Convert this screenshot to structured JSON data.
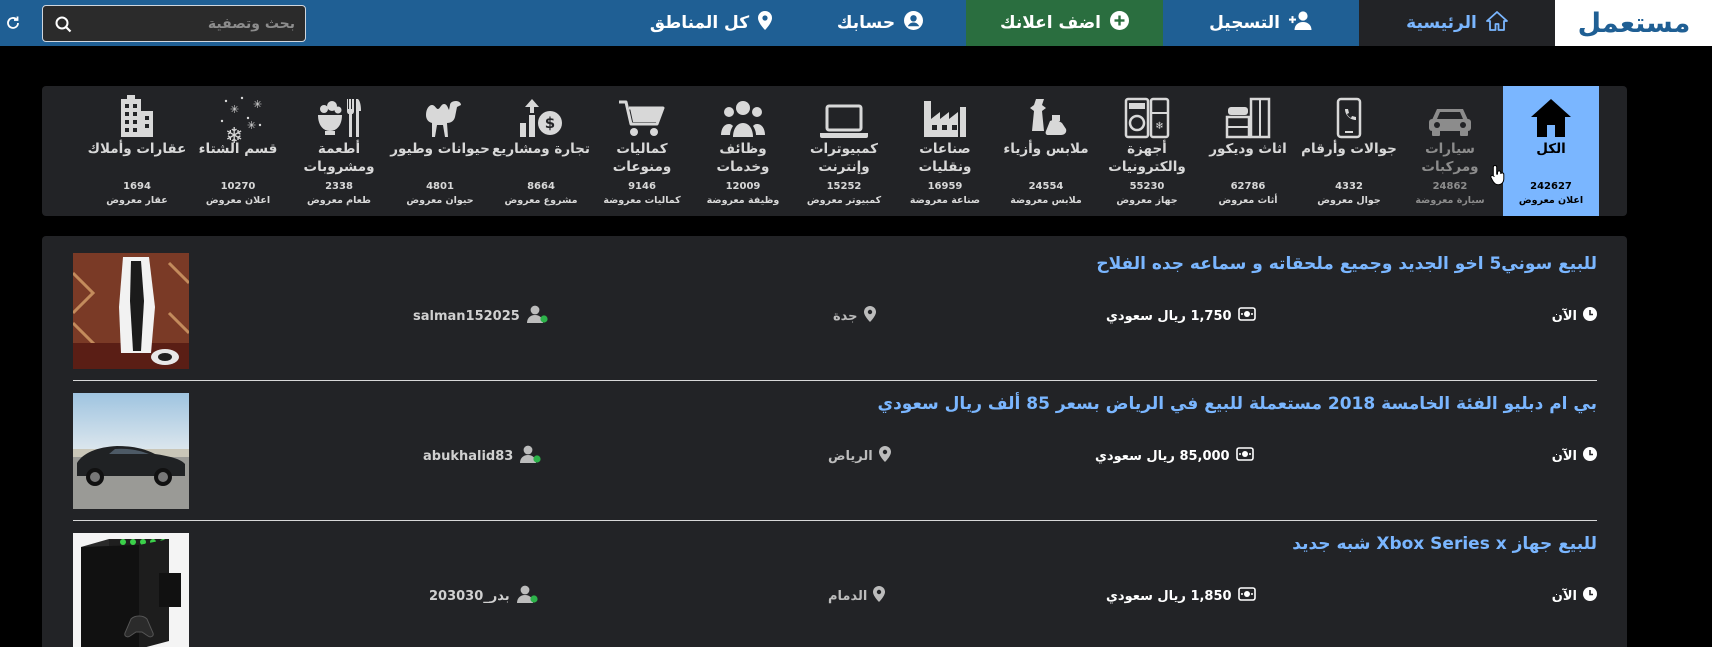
{
  "header": {
    "logo_text": "مستعمل",
    "nav": {
      "home": "الرئيسية",
      "register": "التسجيل",
      "post_ad": "اضف اعلانك",
      "account": "حسابك",
      "regions": "كل المناطق"
    },
    "search": {
      "placeholder": "بحث وتصفية",
      "value": ""
    },
    "icons": [
      "home-icon",
      "user-plus-icon",
      "plus-circle-icon",
      "user-circle-icon",
      "map-pin-icon",
      "search-icon",
      "refresh-icon"
    ],
    "colors": {
      "bar": "#1f5f94",
      "post_ad": "#2a6e3f",
      "home_active": "#222326",
      "home_text": "#7ab6ff"
    }
  },
  "categories": [
    {
      "name": "الكل",
      "count": "242627",
      "unit": "اعلان معروض",
      "icon": "house-icon"
    },
    {
      "name": "سيارات ومركبات",
      "count": "24862",
      "unit": "سيارة معروضة",
      "icon": "car-icon"
    },
    {
      "name": "جوالات وأرقام",
      "count": "4332",
      "unit": "جوال معروض",
      "icon": "phone-icon"
    },
    {
      "name": "اثاث وديكور",
      "count": "62786",
      "unit": "أثاث معروض",
      "icon": "furniture-icon"
    },
    {
      "name": "أجهزة والكترونيات",
      "count": "55230",
      "unit": "جهاز معروض",
      "icon": "appliances-icon"
    },
    {
      "name": "ملابس وأزياء",
      "count": "24554",
      "unit": "ملابس معروضة",
      "icon": "clothes-icon"
    },
    {
      "name": "صناعات ونقليات",
      "count": "16959",
      "unit": "صناعة معروضة",
      "icon": "factory-icon"
    },
    {
      "name": "كمبيوترات وإنترنت",
      "count": "15252",
      "unit": "كمبيوتر معروض",
      "icon": "laptop-icon"
    },
    {
      "name": "وظائف وخدمات",
      "count": "12009",
      "unit": "وظيفة معروضة",
      "icon": "people-icon"
    },
    {
      "name": "كماليات ومنوعات",
      "count": "9146",
      "unit": "كماليات معروضة",
      "icon": "cart-icon"
    },
    {
      "name": "تجارة ومشاريع",
      "count": "8664",
      "unit": "مشروع معروض",
      "icon": "trade-icon"
    },
    {
      "name": "حيوانات وطيور",
      "count": "4801",
      "unit": "حيوان معروض",
      "icon": "camel-icon"
    },
    {
      "name": "أطعمة ومشروبات",
      "count": "2338",
      "unit": "طعام معروض",
      "icon": "food-icon"
    },
    {
      "name": "قسم الشتاء",
      "count": "10270",
      "unit": "اعلان معروض",
      "icon": "snow-icon"
    },
    {
      "name": "عقارات وأملاك",
      "count": "1694",
      "unit": "عقار معروض",
      "icon": "building-icon"
    }
  ],
  "listings": [
    {
      "title": "للبيع سوني5 اخو الجديد وجميع ملحقاته و سماعه جده الفلاح",
      "time": "الآن",
      "price": "1,750 ريال سعودي",
      "city": "جدة",
      "user": "salman152025",
      "thumb": "ps5-photo"
    },
    {
      "title": "بي ام دبليو الفئة الخامسة 2018 مستعملة للبيع في الرياض بسعر 85 ألف ريال سعودي",
      "time": "الآن",
      "price": "85,000 ريال سعودي",
      "city": "الرياض",
      "user": "abukhalid83",
      "thumb": "car-photo"
    },
    {
      "title": "للبيع جهاز Xbox Series x شبه جديد",
      "time": "الآن",
      "price": "1,850 ريال سعودي",
      "city": "الدمام",
      "user": "بدر_203030",
      "thumb": "xbox-photo"
    }
  ]
}
